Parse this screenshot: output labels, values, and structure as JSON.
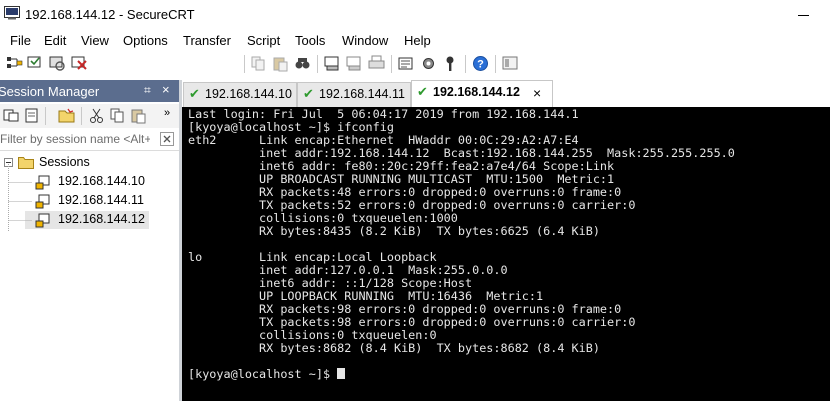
{
  "window": {
    "title": "192.168.144.12 - SecureCRT"
  },
  "menu": [
    "File",
    "Edit",
    "View",
    "Options",
    "Transfer",
    "Script",
    "Tools",
    "Window",
    "Help"
  ],
  "toolbar": {
    "host_placeholder": "Enter host <Alt+R>"
  },
  "session_manager": {
    "title": "Session Manager",
    "pin_glyph": "⌗",
    "close_glyph": "×",
    "filter_placeholder": "Filter by session name <Alt+I>",
    "root_label": "Sessions",
    "sessions": [
      "192.168.144.10",
      "192.168.144.11",
      "192.168.144.12"
    ],
    "selected_index": 2
  },
  "tabs": [
    {
      "label": "192.168.144.10",
      "active": false
    },
    {
      "label": "192.168.144.11",
      "active": false
    },
    {
      "label": "192.168.144.12",
      "active": true
    }
  ],
  "tab_check_glyph": "✔",
  "tab_close_glyph": "×",
  "terminal": {
    "lines": [
      "Last login: Fri Jul  5 06:04:17 2019 from 192.168.144.1",
      "[kyoya@localhost ~]$ ifconfig",
      "eth2      Link encap:Ethernet  HWaddr 00:0C:29:A2:A7:E4",
      "          inet addr:192.168.144.12  Bcast:192.168.144.255  Mask:255.255.255.0",
      "          inet6 addr: fe80::20c:29ff:fea2:a7e4/64 Scope:Link",
      "          UP BROADCAST RUNNING MULTICAST  MTU:1500  Metric:1",
      "          RX packets:48 errors:0 dropped:0 overruns:0 frame:0",
      "          TX packets:52 errors:0 dropped:0 overruns:0 carrier:0",
      "          collisions:0 txqueuelen:1000",
      "          RX bytes:8435 (8.2 KiB)  TX bytes:6625 (6.4 KiB)",
      "",
      "lo        Link encap:Local Loopback",
      "          inet addr:127.0.0.1  Mask:255.0.0.0",
      "          inet6 addr: ::1/128 Scope:Host",
      "          UP LOOPBACK RUNNING  MTU:16436  Metric:1",
      "          RX packets:98 errors:0 dropped:0 overruns:0 frame:0",
      "          TX packets:98 errors:0 dropped:0 overruns:0 carrier:0",
      "          collisions:0 txqueuelen:0",
      "          RX bytes:8682 (8.4 KiB)  TX bytes:8682 (8.4 KiB)",
      ""
    ],
    "prompt": "[kyoya@localhost ~]$ "
  },
  "colors": {
    "terminal_bg": "#000000",
    "terminal_fg": "#e6e6e6",
    "session_header_bg": "#5b6d8e",
    "tab_check": "#2e9a2e"
  }
}
